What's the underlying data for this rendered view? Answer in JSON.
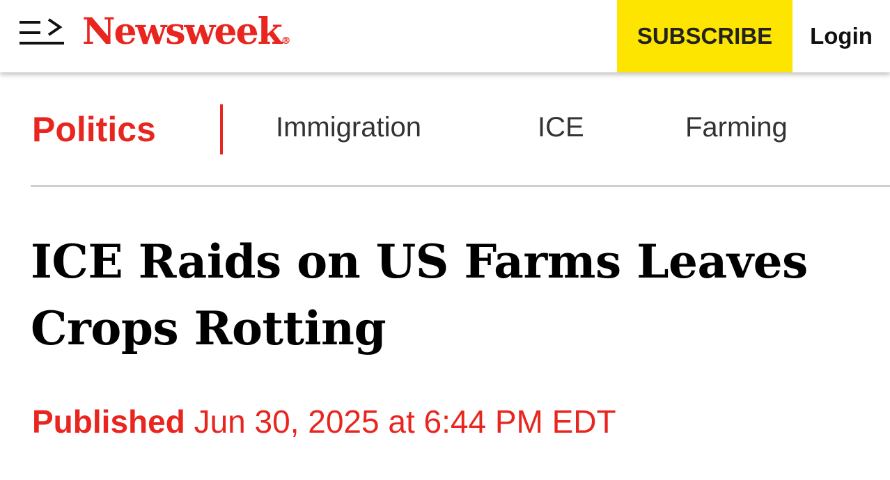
{
  "header": {
    "logo_text": "Newsweek",
    "logo_mark": "®",
    "menu_icon": "menu-arrow-icon",
    "subscribe_label": "SUBSCRIBE",
    "login_label": "Login"
  },
  "nav": {
    "category": "Politics",
    "tags": [
      "Immigration",
      "ICE",
      "Farming"
    ]
  },
  "article": {
    "headline": "ICE Raids on US Farms Leaves Crops Rotting",
    "published_label": "Published",
    "published_date": "Jun 30, 2025 at 6:44 PM EDT"
  },
  "colors": {
    "brand_red": "#e8261f",
    "subscribe_yellow": "#fde500",
    "text_dark": "#000000",
    "tag_gray": "#333333"
  }
}
